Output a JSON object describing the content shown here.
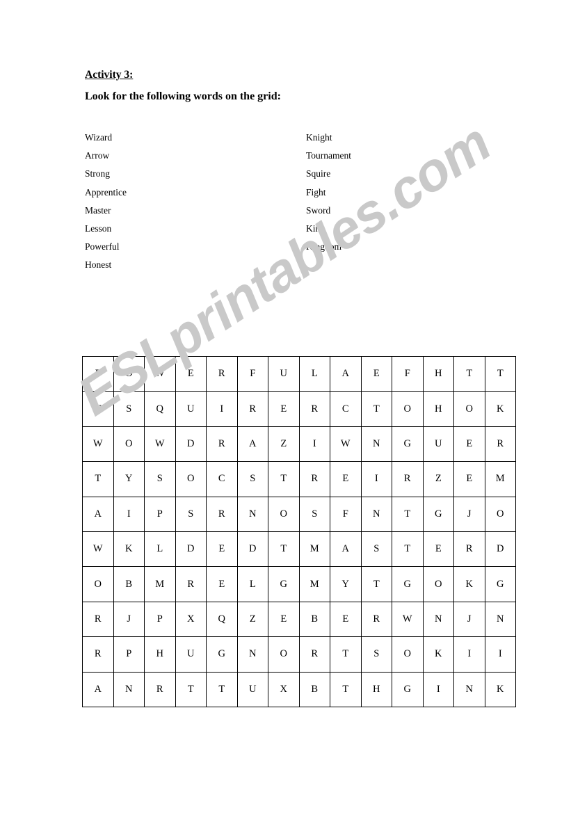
{
  "worksheet": {
    "heading": "Activity 3:",
    "instruction": "Look for the following words on the grid:",
    "watermark": "ESLprintables.com",
    "watermark_color": "#c9c9c9"
  },
  "word_list": {
    "left_column": [
      "Wizard",
      "Arrow",
      "Strong",
      "Apprentice",
      "Master",
      "Lesson",
      "Powerful",
      "Honest"
    ],
    "right_column": [
      "Knight",
      "Tournament",
      "Squire",
      "Fight",
      "Sword",
      "King",
      "Kingdom"
    ]
  },
  "grid": {
    "rows": 10,
    "columns": 14,
    "letters": [
      [
        "P",
        "O",
        "W",
        "E",
        "R",
        "F",
        "U",
        "L",
        "A",
        "E",
        "F",
        "H",
        "T",
        "T"
      ],
      [
        "N",
        "S",
        "Q",
        "U",
        "I",
        "R",
        "E",
        "R",
        "C",
        "T",
        "O",
        "H",
        "O",
        "K"
      ],
      [
        "W",
        "O",
        "W",
        "D",
        "R",
        "A",
        "Z",
        "I",
        "W",
        "N",
        "G",
        "U",
        "E",
        "R"
      ],
      [
        "T",
        "Y",
        "S",
        "O",
        "C",
        "S",
        "T",
        "R",
        "E",
        "I",
        "R",
        "Z",
        "E",
        "M"
      ],
      [
        "A",
        "I",
        "P",
        "S",
        "R",
        "N",
        "O",
        "S",
        "F",
        "N",
        "T",
        "G",
        "J",
        "O"
      ],
      [
        "W",
        "K",
        "L",
        "D",
        "E",
        "D",
        "T",
        "M",
        "A",
        "S",
        "T",
        "E",
        "R",
        "D"
      ],
      [
        "O",
        "B",
        "M",
        "R",
        "E",
        "L",
        "G",
        "M",
        "Y",
        "T",
        "G",
        "O",
        "K",
        "G"
      ],
      [
        "R",
        "J",
        "P",
        "X",
        "Q",
        "Z",
        "E",
        "B",
        "E",
        "R",
        "W",
        "N",
        "J",
        "N"
      ],
      [
        "R",
        "P",
        "H",
        "U",
        "G",
        "N",
        "O",
        "R",
        "T",
        "S",
        "O",
        "K",
        "I",
        "I"
      ],
      [
        "A",
        "N",
        "R",
        "T",
        "T",
        "U",
        "X",
        "B",
        "T",
        "H",
        "G",
        "I",
        "N",
        "K"
      ]
    ]
  }
}
